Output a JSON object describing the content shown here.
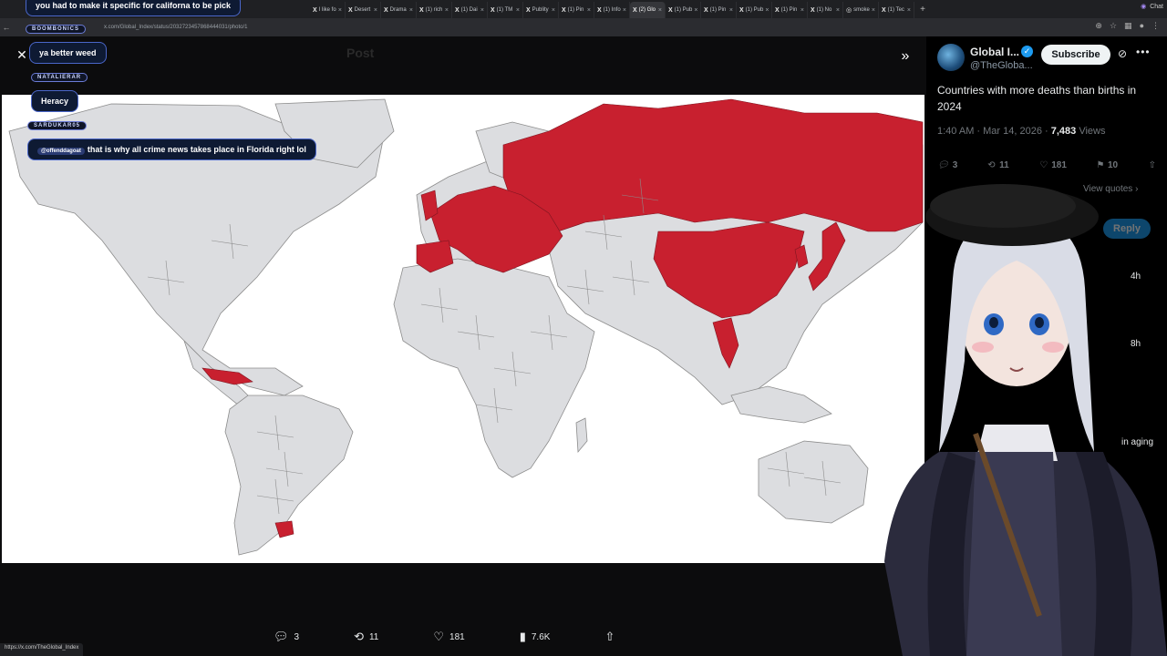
{
  "browser": {
    "tabs": [
      {
        "label": "I like fo",
        "fav": "X"
      },
      {
        "label": "Desert",
        "fav": "X"
      },
      {
        "label": "Drama",
        "fav": "X"
      },
      {
        "label": "(1) rich",
        "fav": "X"
      },
      {
        "label": "(1) Dai",
        "fav": "X"
      },
      {
        "label": "(1) TM",
        "fav": "X"
      },
      {
        "label": "Publity",
        "fav": "X"
      },
      {
        "label": "(1) Pin",
        "fav": "X"
      },
      {
        "label": "(1) Info",
        "fav": "X"
      },
      {
        "label": "(2) Glo",
        "fav": "X"
      },
      {
        "label": "(1) Pub",
        "fav": "X"
      },
      {
        "label": "(1) Pin",
        "fav": "X"
      },
      {
        "label": "(1) Pub",
        "fav": "X"
      },
      {
        "label": "(1) Pin",
        "fav": "X"
      },
      {
        "label": "(1) No",
        "fav": "X"
      },
      {
        "label": "smoke",
        "fav": "◎"
      },
      {
        "label": "(1) Tec",
        "fav": "X"
      }
    ],
    "new_tab": "+",
    "chat_label": "Chat",
    "url": "x.com/Global_Index/status/2032723457868444031/photo/1",
    "status_url": "https://x.com/TheGlobal_Index"
  },
  "viewer": {
    "dim_header": "Post",
    "close": "✕",
    "collapse": "»",
    "toolbar": {
      "replies": "3",
      "reposts": "11",
      "likes": "181",
      "views": "7.6K"
    }
  },
  "map": {
    "highlight_color": "#c8202f",
    "land_color": "#dcdde0",
    "border_color": "#8c8c8c",
    "highlighted_regions": [
      "Russia",
      "Europe",
      "Japan",
      "South Korea",
      "China",
      "Thailand",
      "Cuba",
      "Uruguay",
      "Spain",
      "Portugal"
    ]
  },
  "post": {
    "author_name": "Global I...",
    "author_handle": "@TheGloba...",
    "subscribe": "Subscribe",
    "text": "Countries with more deaths than births in 2024",
    "time": "1:40 AM · Mar 14, 2026 · ",
    "views_count": "7,483",
    "views_label": " Views",
    "replies": "3",
    "reposts": "11",
    "likes": "181",
    "bookmarks": "10",
    "view_quotes": "View quotes ›",
    "reply_button": "Reply",
    "faded_1": "4h",
    "faded_2": "8h",
    "faded_3": "in aging"
  },
  "chat": {
    "messages": [
      {
        "user": "",
        "text": "you had to make it specific for californa to be pick"
      },
      {
        "user": "BOOMBONICS",
        "text": "ya better weed"
      },
      {
        "user": "NATALIERAR",
        "text": "Heracy"
      },
      {
        "user": "SARDUKAR05",
        "mention": "@offenddagoat",
        "text": "that is why all crime news takes place in Florida right lol"
      }
    ]
  },
  "colors": {
    "accent": "#1d9bf0",
    "map_red": "#c8202f",
    "chat_border": "#4a66c9"
  }
}
